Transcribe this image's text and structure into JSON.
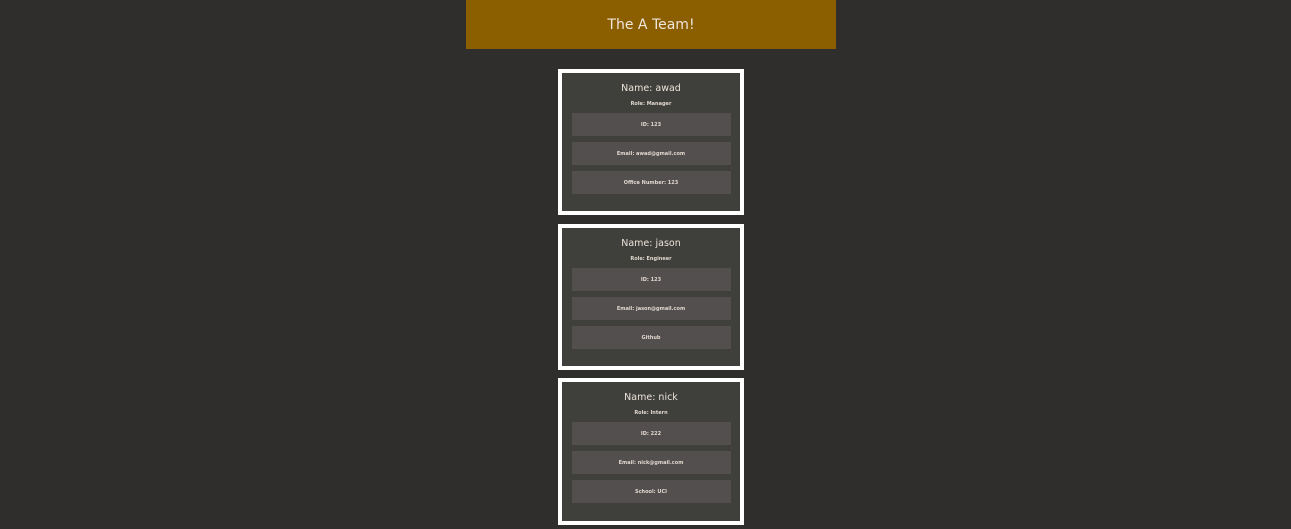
{
  "header": {
    "title": "The A Team!"
  },
  "team": [
    {
      "name": "Name: awad",
      "role": "Role: Manager",
      "fields": [
        "ID: 123",
        "Email: awad@gmail.com",
        "Office Number: 123"
      ]
    },
    {
      "name": "Name: jason",
      "role": "Role: Engineer",
      "fields": [
        "ID: 123",
        "Email: jason@gmail.com",
        "Github"
      ]
    },
    {
      "name": "Name: nick",
      "role": "Role: Intern",
      "fields": [
        "ID: 222",
        "Email: nick@gmail.com",
        "School: UCI"
      ]
    }
  ],
  "colors": {
    "background": "#302e2c",
    "header": "#8b5e00",
    "card": "#3f3f3b",
    "card_border": "#ffffff",
    "field": "#534f4f"
  }
}
